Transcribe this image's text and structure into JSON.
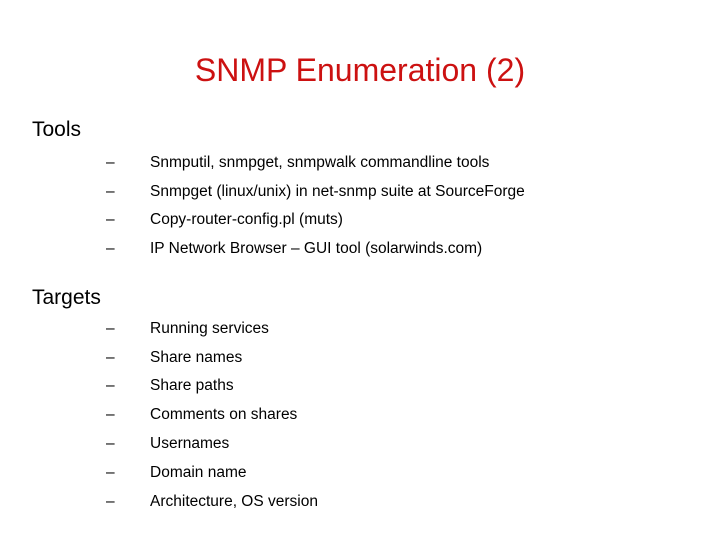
{
  "slide": {
    "title": "SNMP Enumeration (2)",
    "title_color": "#cc1111",
    "background_color": "#ffffff",
    "bullet_glyph": "–",
    "sections": [
      {
        "heading": "Tools",
        "items": [
          "Snmputil, snmpget, snmpwalk commandline tools",
          "Snmpget (linux/unix) in net-snmp suite at SourceForge",
          "Copy-router-config.pl (muts)",
          "IP Network Browser – GUI tool (solarwinds.com)"
        ]
      },
      {
        "heading": "Targets",
        "items": [
          "Running services",
          "Share names",
          "Share paths",
          "Comments on shares",
          "Usernames",
          "Domain name",
          "Architecture, OS version"
        ]
      }
    ]
  }
}
